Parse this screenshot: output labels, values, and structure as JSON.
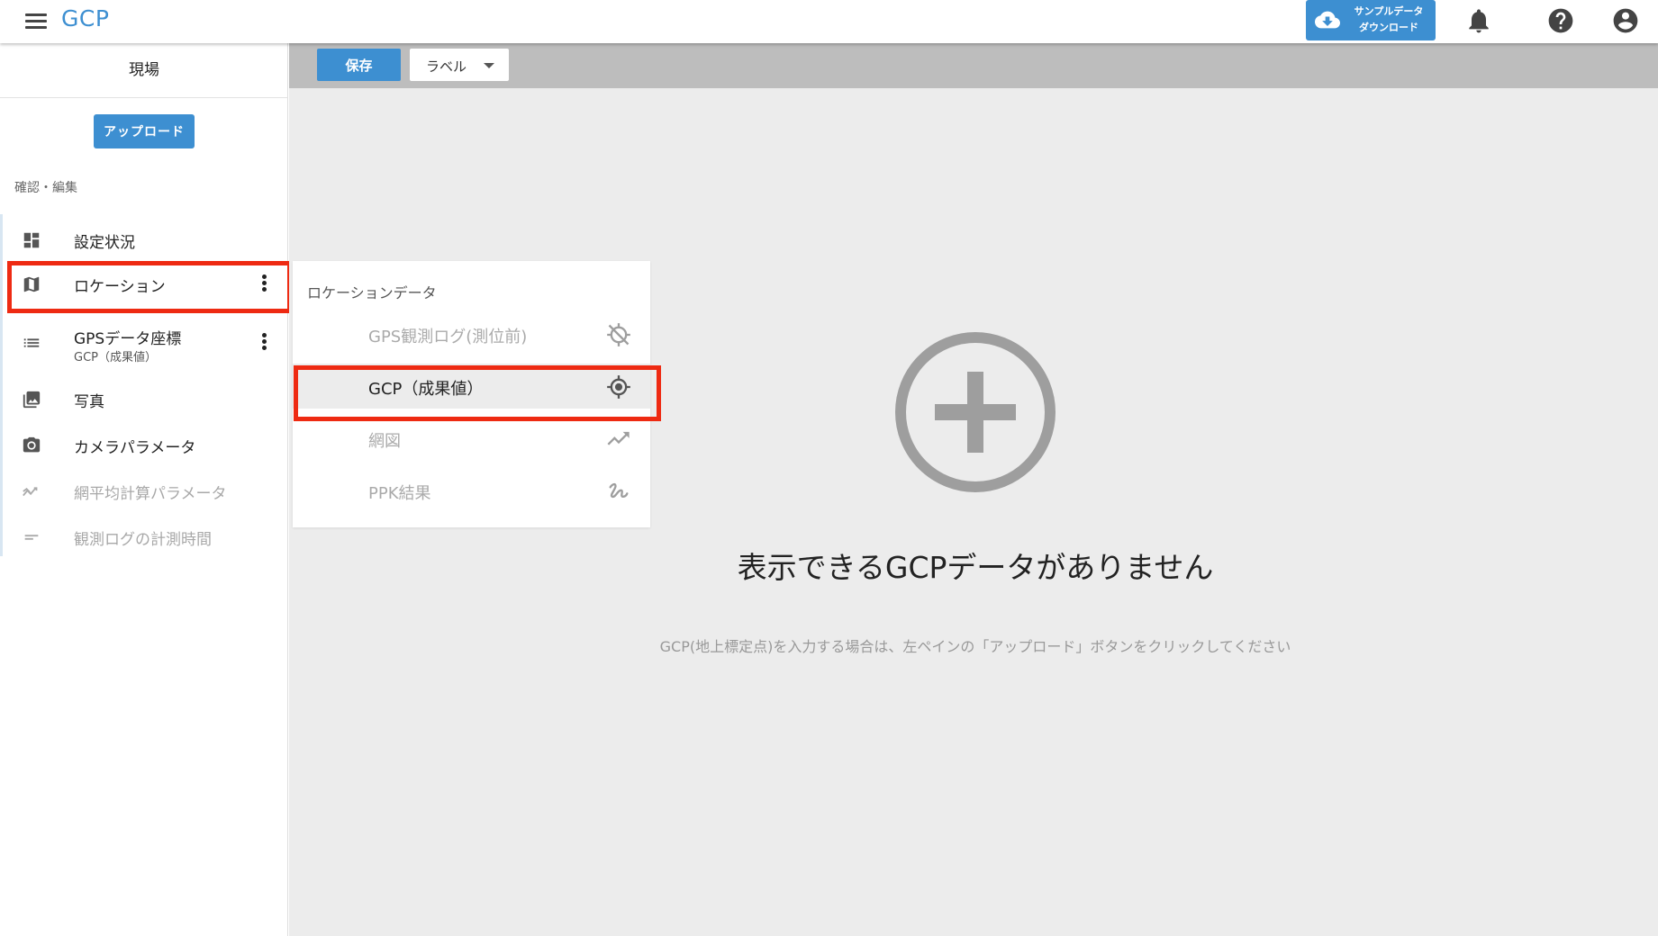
{
  "header": {
    "app_title": "GCP",
    "sample_download_label_line1": "サンプルデータ",
    "sample_download_label_line2": "ダウンロード"
  },
  "sidebar": {
    "site_title": "現場",
    "upload_label": "アップロード",
    "section_label": "確認・編集",
    "items": [
      {
        "label": "設定状況",
        "icon": "dashboard-icon",
        "enabled": true
      },
      {
        "label": "ロケーション",
        "icon": "map-icon",
        "enabled": true,
        "highlighted": true
      },
      {
        "label": "GPSデータ座標",
        "sublabel": "GCP（成果値）",
        "icon": "list-icon",
        "enabled": true
      },
      {
        "label": "写真",
        "icon": "photo-icon",
        "enabled": true
      },
      {
        "label": "カメラパラメータ",
        "icon": "camera-icon",
        "enabled": true
      },
      {
        "label": "網平均計算パラメータ",
        "icon": "trend-icon",
        "enabled": false
      },
      {
        "label": "観測ログの計測時間",
        "icon": "text-lines-icon",
        "enabled": false
      }
    ]
  },
  "toolbar": {
    "save_label": "保存",
    "label_select_value": "ラベル"
  },
  "submenu": {
    "heading": "ロケーションデータ",
    "items": [
      {
        "label": "GPS観測ログ(測位前)",
        "icon": "gps-off-icon",
        "active": false
      },
      {
        "label": "GCP（成果値）",
        "icon": "gps-fixed-icon",
        "active": true
      },
      {
        "label": "網図",
        "icon": "trending-icon",
        "active": false
      },
      {
        "label": "PPK結果",
        "icon": "gesture-icon",
        "active": false
      }
    ]
  },
  "empty_state": {
    "title": "表示できるGCPデータがありません",
    "description": "GCP(地上標定点)を入力する場合は、左ペインの「アップロード」ボタンをクリックしてください"
  },
  "colors": {
    "accent": "#3d8fd1",
    "highlight": "#ee2a12",
    "toolbar_bg": "#bdbdbd",
    "main_bg": "#ececec"
  }
}
